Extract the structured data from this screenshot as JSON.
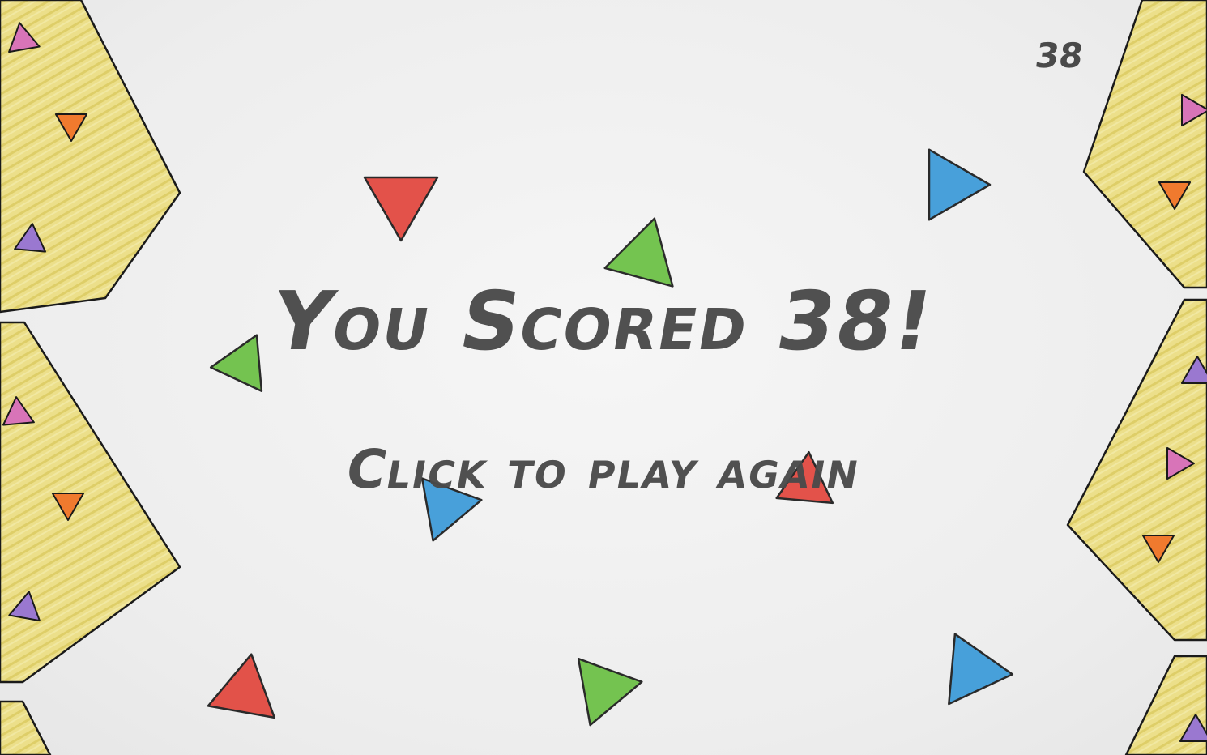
{
  "hud": {
    "score": "38"
  },
  "game_over": {
    "title": "You Scored 38!",
    "prompt": "Click to play again"
  },
  "colors": {
    "ink": "#4a4a4a",
    "wall_fill": "#ecdf8a",
    "wall_stroke": "#1a1a1a",
    "red": "#e2453c",
    "blue": "#3a9ad9",
    "green": "#6ac043",
    "orange": "#f07a2e",
    "purple": "#9a78d0",
    "pink": "#d874b8"
  },
  "walls": [
    {
      "side": "left",
      "studs": [
        "pink",
        "orange",
        "purple"
      ]
    },
    {
      "side": "left",
      "studs": [
        "pink",
        "orange",
        "purple"
      ]
    },
    {
      "side": "left",
      "studs": []
    },
    {
      "side": "right",
      "studs": [
        "pink",
        "orange"
      ]
    },
    {
      "side": "right",
      "studs": [
        "purple",
        "pink",
        "orange"
      ]
    },
    {
      "side": "right",
      "studs": [
        "purple"
      ]
    }
  ],
  "floating_triangles": [
    "red",
    "blue",
    "green",
    "green",
    "blue",
    "red",
    "red",
    "green",
    "blue"
  ]
}
